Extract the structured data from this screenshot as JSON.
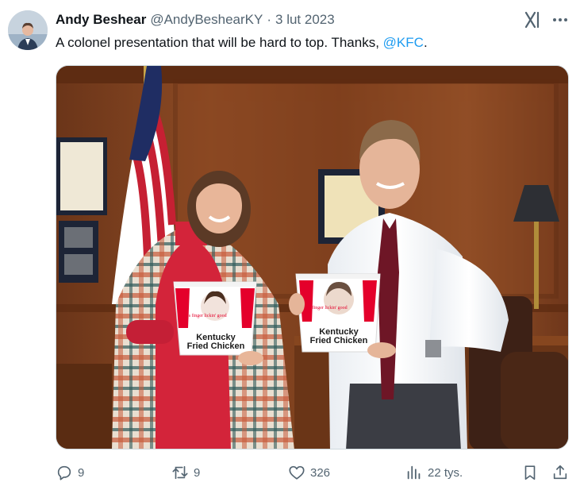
{
  "tweet": {
    "author_name": "Andy Beshear",
    "handle": "@AndyBeshearKY",
    "separator": "·",
    "date": "3 lut 2023",
    "text": "A colonel presentation that will be hard to top. Thanks, ",
    "mention": "@KFC",
    "text_end": ".",
    "bucket_slogan": "It's finger lickin' good",
    "bucket_brand_line1": "Kentucky",
    "bucket_brand_line2": "Fried Chicken"
  },
  "actions": {
    "replies": "9",
    "retweets": "9",
    "likes": "326",
    "views": "22 tys."
  },
  "icons": {
    "header": [
      "grok-icon",
      "more-icon"
    ],
    "actions": [
      "reply-icon",
      "retweet-icon",
      "like-icon",
      "views-icon",
      "bookmark-icon",
      "share-icon"
    ]
  },
  "colors": {
    "accent": "#1d9bf0",
    "text_primary": "#0f1419",
    "text_secondary": "#536471",
    "kfc_red": "#e4002b"
  }
}
